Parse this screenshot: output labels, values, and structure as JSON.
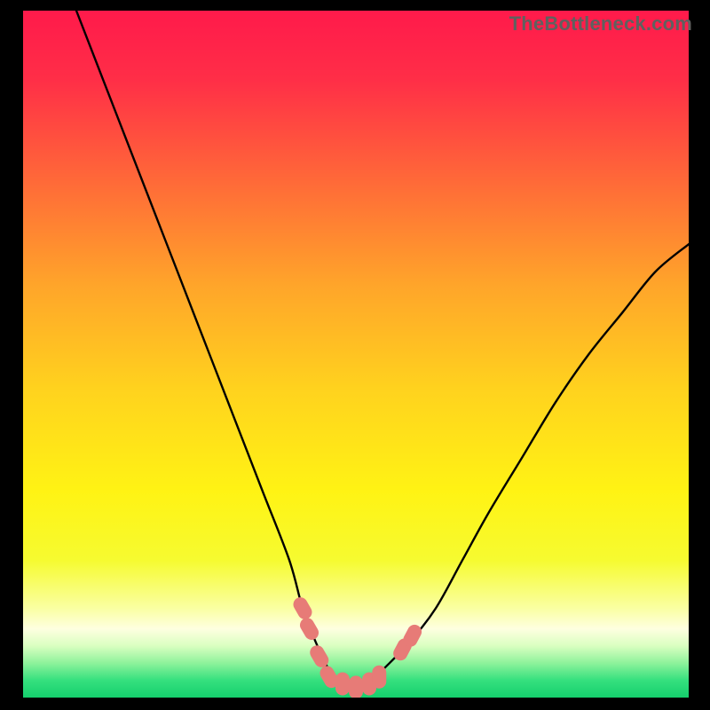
{
  "watermark": "TheBottleneck.com",
  "chart_data": {
    "type": "line",
    "title": "",
    "xlabel": "",
    "ylabel": "",
    "xlim": [
      0,
      100
    ],
    "ylim": [
      0,
      100
    ],
    "series": [
      {
        "name": "bottleneck-curve",
        "x": [
          8,
          12,
          16,
          20,
          24,
          28,
          32,
          36,
          40,
          42,
          44,
          46,
          48,
          50,
          52,
          54,
          58,
          62,
          66,
          70,
          75,
          80,
          85,
          90,
          95,
          100
        ],
        "values": [
          100,
          90,
          80,
          70,
          60,
          50,
          40,
          30,
          20,
          13,
          8,
          4,
          2,
          1.5,
          2,
          4,
          8,
          13,
          20,
          27,
          35,
          43,
          50,
          56,
          62,
          66
        ]
      }
    ],
    "markers": [
      {
        "name": "left-cluster-1",
        "x": 42.0,
        "y": 13.0
      },
      {
        "name": "left-cluster-2",
        "x": 43.0,
        "y": 10.0
      },
      {
        "name": "left-cluster-3",
        "x": 44.5,
        "y": 6.0
      },
      {
        "name": "trough-1",
        "x": 46.0,
        "y": 3.0
      },
      {
        "name": "trough-2",
        "x": 48.0,
        "y": 2.0
      },
      {
        "name": "trough-3",
        "x": 50.0,
        "y": 1.5
      },
      {
        "name": "trough-4",
        "x": 52.0,
        "y": 2.0
      },
      {
        "name": "trough-5",
        "x": 53.5,
        "y": 3.0
      },
      {
        "name": "right-cluster-1",
        "x": 57.0,
        "y": 7.0
      },
      {
        "name": "right-cluster-2",
        "x": 58.5,
        "y": 9.0
      }
    ],
    "gradient_stops": [
      {
        "offset": 0.0,
        "color": "#ff1a4b"
      },
      {
        "offset": 0.1,
        "color": "#ff2e47"
      },
      {
        "offset": 0.25,
        "color": "#ff6a38"
      },
      {
        "offset": 0.4,
        "color": "#ffa52a"
      },
      {
        "offset": 0.55,
        "color": "#ffd21e"
      },
      {
        "offset": 0.7,
        "color": "#fff314"
      },
      {
        "offset": 0.8,
        "color": "#f6fb30"
      },
      {
        "offset": 0.87,
        "color": "#faffa2"
      },
      {
        "offset": 0.9,
        "color": "#feffe0"
      },
      {
        "offset": 0.925,
        "color": "#d9ffc0"
      },
      {
        "offset": 0.95,
        "color": "#8df29b"
      },
      {
        "offset": 0.975,
        "color": "#35e07e"
      },
      {
        "offset": 1.0,
        "color": "#15cf6d"
      }
    ],
    "marker_color": "#e77b77",
    "curve_color": "#000000"
  }
}
